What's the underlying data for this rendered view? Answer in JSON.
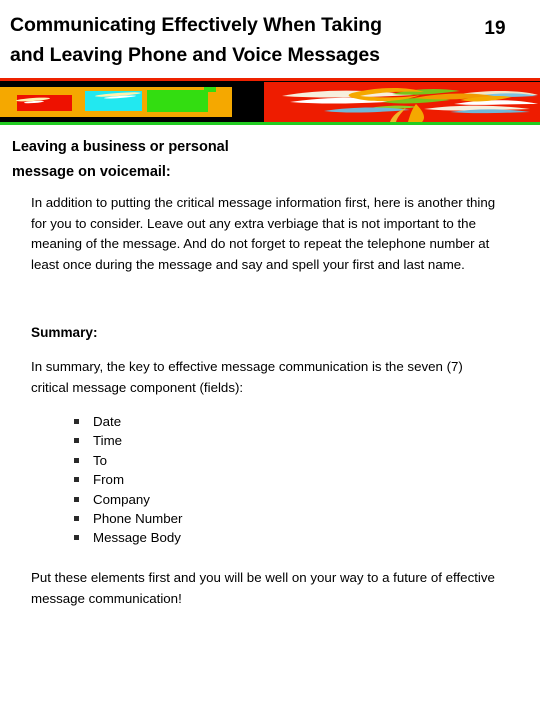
{
  "slide": {
    "title": "Communicating Effectively When Taking\nand Leaving Phone and Voice Messages",
    "page_number": "19"
  },
  "banner": {
    "name": "decorative-color-banner",
    "colors": {
      "background": "#000000",
      "rule_top": "#ee2200",
      "rule_bottom": "#22cc22",
      "left_panel": "#f5a800",
      "block_red": "#ee1100",
      "block_cyan": "#22e8f0",
      "block_green": "#33dd11",
      "right_panel": "#ee1c00",
      "swirl_orange": "#f5a800",
      "swirl_green": "#7ac21a",
      "swirl_blue": "#6fb7d8",
      "swirl_cream": "#f3e6c8"
    }
  },
  "body": {
    "section_heading": "Leaving a business or personal\nmessage on voicemail:",
    "intro_paragraph": "In addition to putting the critical message information first, here is another thing for you to consider.  Leave out any extra verbiage that is not important to the meaning of the message.  And do not forget to repeat the telephone number at least once during the message and say and spell your first and last name.",
    "summary_heading": "Summary:",
    "summary_paragraph": "In summary, the key to effective message communication is the seven (7) critical message component (fields):",
    "field_list": [
      "Date",
      "Time",
      "To",
      "From",
      "Company",
      "Phone Number",
      "Message Body"
    ],
    "closing_paragraph": "Put these elements first and you will be well on your way to a future of effective message communication!"
  }
}
